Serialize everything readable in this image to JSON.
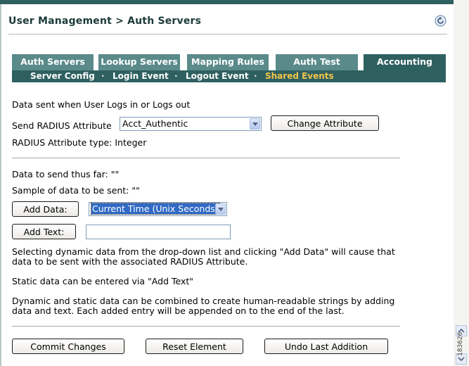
{
  "header": {
    "title": "User Management > Auth Servers"
  },
  "tabs": [
    {
      "label": "Auth Servers",
      "active": false
    },
    {
      "label": "Lookup Servers",
      "active": false
    },
    {
      "label": "Mapping Rules",
      "active": false
    },
    {
      "label": "Auth Test",
      "active": false
    },
    {
      "label": "Accounting",
      "active": true
    }
  ],
  "subnav": {
    "items": [
      "Server Config",
      "Login Event",
      "Logout Event",
      "Shared Events"
    ],
    "separator": "·",
    "current": "Shared Events"
  },
  "section1": {
    "intro": "Data sent when User Logs in or Logs out",
    "send_label": "Send RADIUS Attribute",
    "attribute_value": "Acct_Authentic",
    "change_button": "Change Attribute",
    "type_text": "RADIUS Attribute type: Integer"
  },
  "section2": {
    "data_so_far": "Data to send thus far: \"\"",
    "sample": "Sample of data to be sent: \"\"",
    "add_data_button": "Add Data:",
    "dynamic_value": "Current Time (Unix Seconds)",
    "add_text_button": "Add Text:",
    "add_text_value": "",
    "help1_line1": "Selecting dynamic data from the drop-down list and clicking \"Add Data\" will cause that",
    "help1_line2": "data to be sent with the associated RADIUS Attribute.",
    "help2": "Static data can be entered via \"Add Text\"",
    "help3_line1": "Dynamic and static data can be combined to create human-readable strings by adding",
    "help3_line2": "data and text. Each added entry will be appended on to the end of the last."
  },
  "footer": {
    "commit_button": "Commit Changes",
    "reset_button": "Reset Element",
    "undo_button": "Undo Last Addition"
  },
  "figure_id": "183626",
  "colors": {
    "tab": "#5a8a8a",
    "tab_active": "#2f6060",
    "subnav_current": "#f2c54a"
  }
}
